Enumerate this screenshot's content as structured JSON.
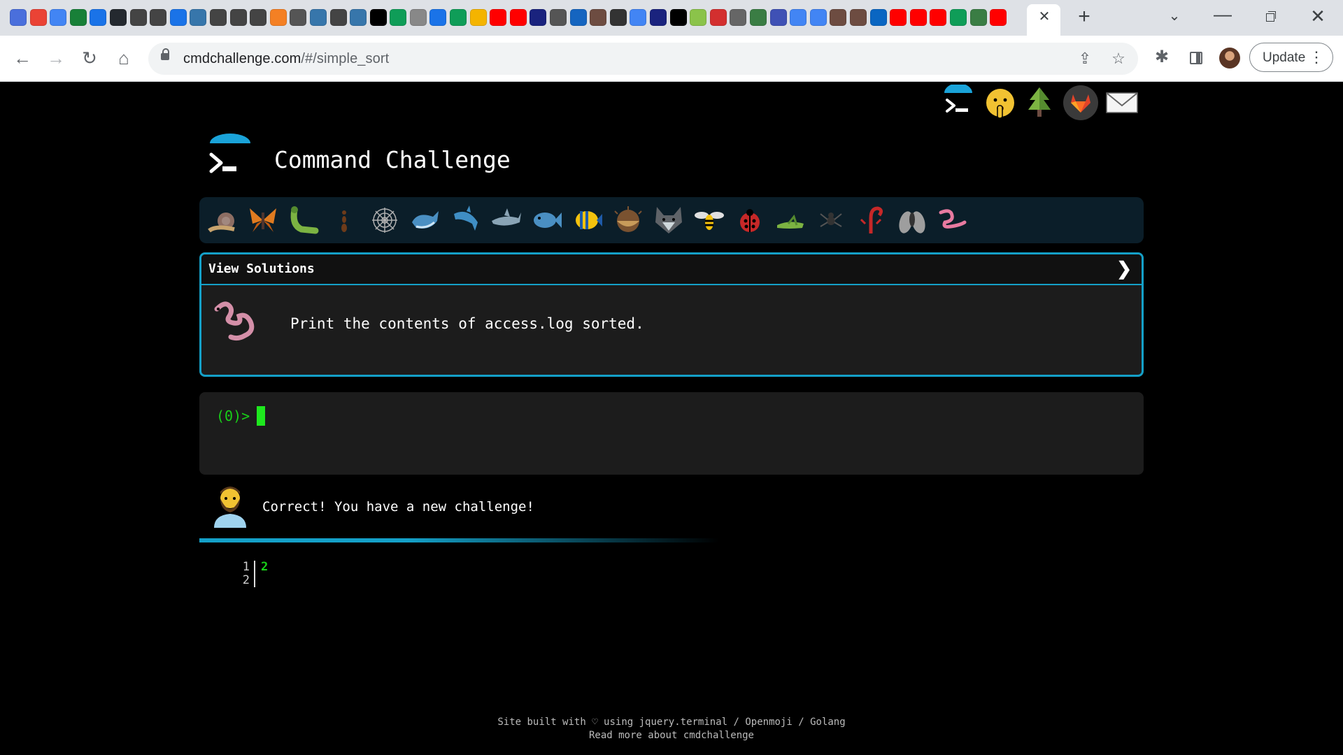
{
  "browser": {
    "favicons": [
      "#4a6fdc",
      "#ea4335",
      "#4285f4",
      "#188038",
      "#1a73e8",
      "#24292f",
      "#444",
      "#444",
      "#1a73e8",
      "#3776ab",
      "#444",
      "#444",
      "#444",
      "#f48024",
      "#555",
      "#3776ab",
      "#444",
      "#3776ab",
      "#000",
      "#0f9d58",
      "#888",
      "#1a73e8",
      "#0f9d58",
      "#f4b400",
      "#ff0000",
      "#ff0000",
      "#1a237e",
      "#555",
      "#1565c0",
      "#6d4c41",
      "#333",
      "#4285f4",
      "#1a237e",
      "#000",
      "#8bc34a",
      "#d32f2f",
      "#666",
      "#3a7d44",
      "#3f51b5",
      "#4285f4",
      "#4285f4",
      "#6d4c41",
      "#6d4c41",
      "#0a66c2",
      "#ff0000",
      "#ff0000",
      "#ff0000",
      "#0f9d58",
      "#3a7d44",
      "#ff0000"
    ],
    "tab_close": "✕",
    "new_tab": "+",
    "window": {
      "chevron": "⌄",
      "minimize": "—",
      "close": "✕"
    },
    "nav": {
      "back": "←",
      "forward": "→",
      "reload": "↻",
      "home": "⌂"
    },
    "url_host": "cmdchallenge.com",
    "url_path": "/#/simple_sort",
    "icons": {
      "share": "⇪",
      "star": "☆",
      "extensions": "✱"
    },
    "update_label": "Update",
    "menu": "⋮"
  },
  "site": {
    "title": "Command Challenge",
    "top_icons": [
      "terminal-icon",
      "shushing-face-icon",
      "tree-icon",
      "gitlab-icon",
      "mail-icon"
    ],
    "levels": [
      "snail",
      "butterfly",
      "caterpillar",
      "ant",
      "spider-web",
      "whale",
      "dolphin",
      "shark",
      "fish",
      "tropical-fish",
      "puffer",
      "wolf",
      "bee",
      "ladybug",
      "grasshopper",
      "spider",
      "scorpion",
      "fly",
      "worm"
    ],
    "solutions_label": "View Solutions",
    "solutions_chevron": "❯",
    "challenge_text": "Print the contents of access.log sorted.",
    "prompt": "(0)>",
    "feedback": "Correct! You have a new challenge!",
    "progress": 0.55,
    "output": {
      "line_numbers": "1\n2",
      "lines": "2"
    },
    "footer": {
      "line1": "Site built with ♡ using jquery.terminal / Openmoji / Golang",
      "line2": "Read more about cmdchallenge"
    }
  }
}
